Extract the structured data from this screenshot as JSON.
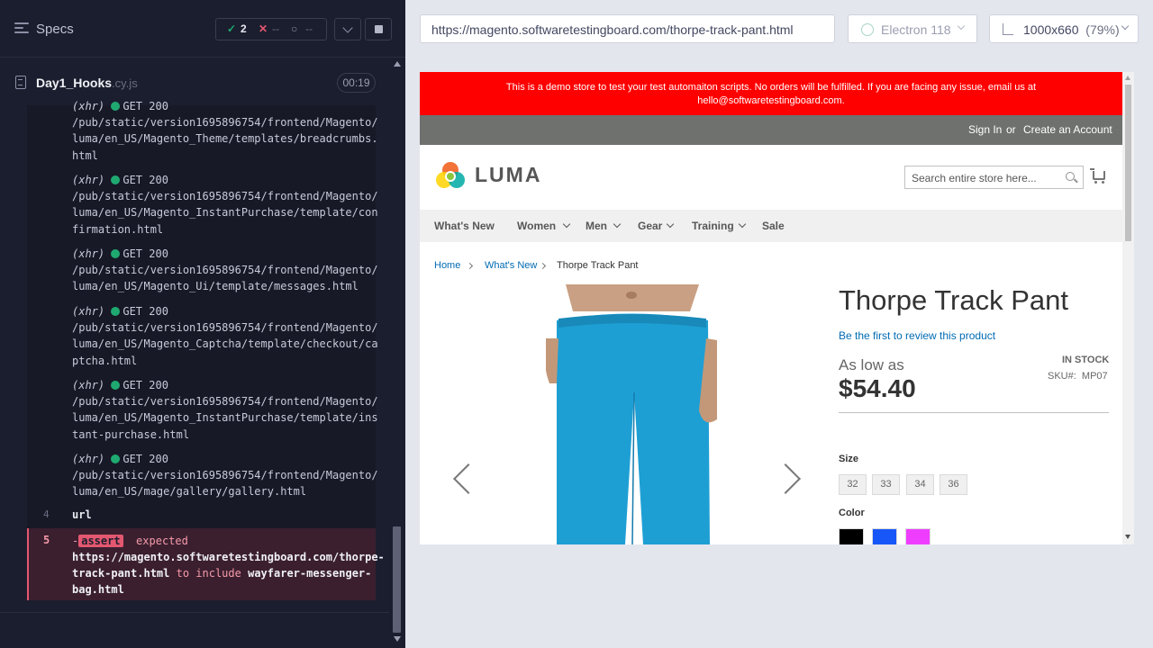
{
  "reporter": {
    "specs_label": "Specs",
    "stats": {
      "passed": "2",
      "failed": "--",
      "pending": "--"
    },
    "spec_name": "Day1_Hooks",
    "spec_ext": ".cy.js",
    "duration": "00:19",
    "logs": [
      {
        "method": "(xhr)",
        "status": "GET 200",
        "path": "/pub/static/version1695896754/frontend/Magento/luma/en_US/Magento_Theme/templates/breadcrumbs.html"
      },
      {
        "method": "(xhr)",
        "status": "GET 200",
        "path": "/pub/static/version1695896754/frontend/Magento/luma/en_US/Magento_InstantPurchase/template/confirmation.html"
      },
      {
        "method": "(xhr)",
        "status": "GET 200",
        "path": "/pub/static/version1695896754/frontend/Magento/luma/en_US/Magento_Ui/template/messages.html"
      },
      {
        "method": "(xhr)",
        "status": "GET 200",
        "path": "/pub/static/version1695896754/frontend/Magento/luma/en_US/Magento_Captcha/template/checkout/captcha.html"
      },
      {
        "method": "(xhr)",
        "status": "GET 200",
        "path": "/pub/static/version1695896754/frontend/Magento/luma/en_US/Magento_InstantPurchase/template/instant-purchase.html"
      },
      {
        "method": "(xhr)",
        "status": "GET 200",
        "path": "/pub/static/version1695896754/frontend/Magento/luma/en_US/mage/gallery/gallery.html"
      }
    ],
    "url_cmd": {
      "line": "4",
      "name": "url"
    },
    "assert_cmd": {
      "line": "5",
      "tag": "assert",
      "expected": "expected",
      "actual": "https://magento.softwaretestingboard.com/thorpe-track-pant.html",
      "mid": "to include",
      "target": "wayfarer-messenger-bag.html"
    }
  },
  "aut": {
    "url": "https://magento.softwaretestingboard.com/thorpe-track-pant.html",
    "browser": "Electron 118",
    "viewport": "1000x660",
    "zoom": "(79%)",
    "demo_notice": "This is a demo store to test your test automaiton scripts. No orders will be fulfilled. If you are facing any issue, email us at hello@softwaretestingboard.com.",
    "sign_in": "Sign In",
    "or": "or",
    "create_account": "Create an Account",
    "logo": "LUMA",
    "search_placeholder": "Search entire store here...",
    "nav": [
      "What's New",
      "Women",
      "Men",
      "Gear",
      "Training",
      "Sale"
    ],
    "breadcrumbs": [
      "Home",
      "What's New",
      "Thorpe Track Pant"
    ],
    "product": {
      "title": "Thorpe Track Pant",
      "review_link": "Be the first to review this product",
      "as_low_as": "As low as",
      "price": "$54.40",
      "stock": "IN STOCK",
      "sku_label": "SKU#:",
      "sku": "MP07",
      "size_label": "Size",
      "sizes": [
        "32",
        "33",
        "34",
        "36"
      ],
      "color_label": "Color",
      "colors": [
        "#000000",
        "#1857f7",
        "#ef3dff"
      ]
    }
  }
}
